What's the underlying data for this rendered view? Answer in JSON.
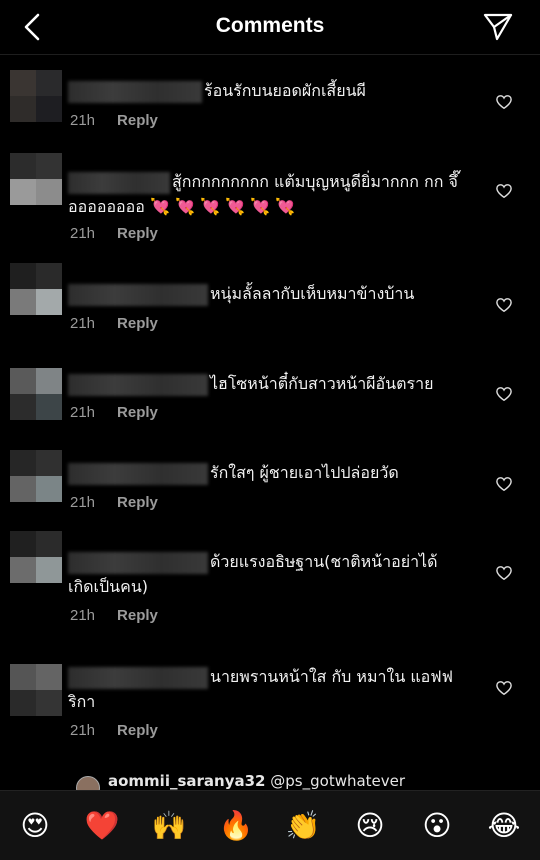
{
  "header": {
    "title": "Comments"
  },
  "comments": [
    {
      "text": "ร้อนรักบนยอดผักเสี้ยนผี",
      "time": "21h",
      "reply": "Reply"
    },
    {
      "text": "สู้กกกกกกกกก แต้มบุญหนูดียิ่มากกก กก จึ๊ออออออออ 💘 💘 💘 💘 💘 💘",
      "time": "21h",
      "reply": "Reply"
    },
    {
      "text": "หนุ่มลั้ลลากับเห็บหมาข้างบ้าน",
      "time": "21h",
      "reply": "Reply"
    },
    {
      "text": "ไฮโซหน้าตี๋กับสาวหน้าผีอันตราย",
      "time": "21h",
      "reply": "Reply"
    },
    {
      "text": "รักใสๆ ผู้ชายเอาไปปล่อยวัด",
      "time": "21h",
      "reply": "Reply"
    },
    {
      "text": "ด้วยแรงอธิษฐาน(ชาติหน้าอย่าได้ เกิดเป็นคน)",
      "time": "21h",
      "reply": "Reply"
    },
    {
      "text": "นายพรานหน้าใส กับ หมาใน แอฟฟริกา",
      "time": "21h",
      "reply": "Reply"
    }
  ],
  "partial_comment": {
    "username": "aommii_saranya32",
    "text": "@ps_gotwhatever"
  },
  "reactions": [
    "😍",
    "❤️",
    "🙌",
    "🔥",
    "👏",
    "😢",
    "😮",
    "😂"
  ],
  "icons": {
    "back": "chevron-left-icon",
    "send": "paper-plane-icon",
    "like": "heart-outline-icon"
  }
}
